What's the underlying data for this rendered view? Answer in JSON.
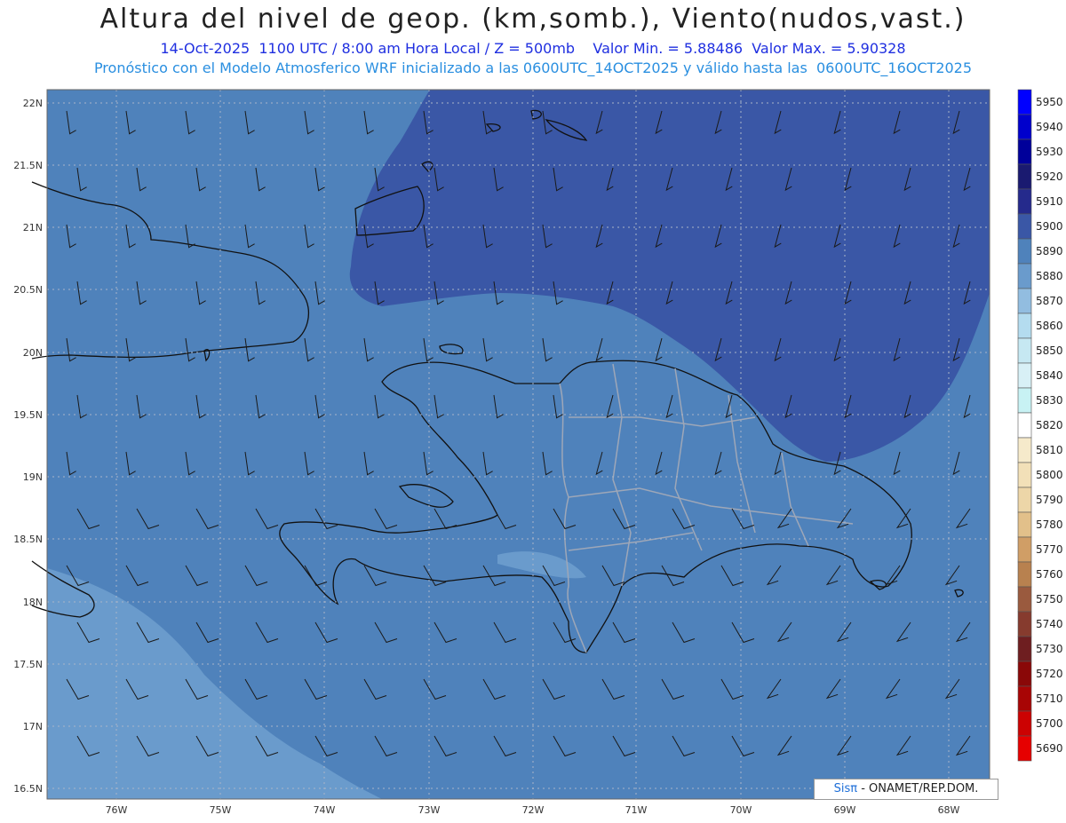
{
  "header": {
    "title": "Altura del nivel de geop. (km,somb.), Viento(nudos,vast.)",
    "line1": "14-Oct-2025  1100 UTC / 8:00 am Hora Local / Z = 500mb    Valor Min. = 5.88486  Valor Max. = 5.90328",
    "line2": "Pronóstico con el Modelo Atmosferico WRF inicializado a las 0600UTC_14OCT2025 y válido hasta las  0600UTC_16OCT2025"
  },
  "credit": {
    "brand": "Sisπ",
    "text": "- ONAMET/REP.DOM."
  },
  "axes": {
    "lat_labels": [
      "22N",
      "21.5N",
      "21N",
      "20.5N",
      "20N",
      "19.5N",
      "19N",
      "18.5N",
      "18N",
      "17.5N",
      "17N",
      "16.5N"
    ],
    "lon_labels": [
      "76W",
      "75W",
      "74W",
      "73W",
      "72W",
      "71W",
      "70W",
      "69W",
      "68W"
    ]
  },
  "colorbar": {
    "levels": [
      "5950",
      "5940",
      "5930",
      "5920",
      "5910",
      "5900",
      "5890",
      "5880",
      "5870",
      "5860",
      "5850",
      "5840",
      "5830",
      "5820",
      "5810",
      "5800",
      "5790",
      "5780",
      "5770",
      "5760",
      "5750",
      "5740",
      "5730",
      "5720",
      "5710",
      "5700",
      "5690"
    ],
    "colors": [
      "#0000ff",
      "#0000cc",
      "#00009a",
      "#1a1a70",
      "#252a8c",
      "#3a57a6",
      "#4f82bb",
      "#6a9bcc",
      "#92bde0",
      "#b4dcef",
      "#c6e8f2",
      "#d8f0f6",
      "#c8f2f4",
      "#ffffff",
      "#f6eacb",
      "#f2e0b8",
      "#edd6a8",
      "#e2c08a",
      "#d09e66",
      "#b8814f",
      "#9a5a3e",
      "#863b2e",
      "#6e1e20",
      "#8a0808",
      "#a80505",
      "#cc0202",
      "#e60000"
    ]
  }
}
